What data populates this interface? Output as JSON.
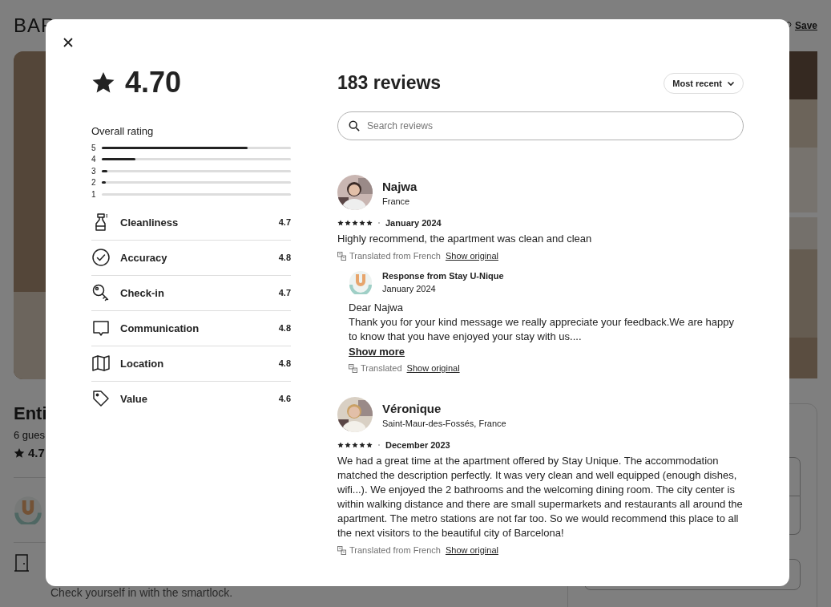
{
  "page": {
    "title": "BAR",
    "save": "Save",
    "listing_title": "Enti",
    "guests": "6 gues",
    "rating": "4.7",
    "checkin_text": "Check yourself in with the smartlock."
  },
  "modal": {
    "score": "4.70",
    "overall_label": "Overall rating",
    "distribution": [
      {
        "label": "5",
        "level": 0.77
      },
      {
        "label": "4",
        "level": 0.18
      },
      {
        "label": "3",
        "level": 0.03
      },
      {
        "label": "2",
        "level": 0.02
      },
      {
        "label": "1",
        "level": 0
      }
    ],
    "categories": [
      {
        "kind": "cleanliness",
        "label": "Cleanliness",
        "value": "4.7"
      },
      {
        "kind": "accuracy",
        "label": "Accuracy",
        "value": "4.8"
      },
      {
        "kind": "checkin",
        "label": "Check-in",
        "value": "4.7"
      },
      {
        "kind": "communication",
        "label": "Communication",
        "value": "4.8"
      },
      {
        "kind": "location",
        "label": "Location",
        "value": "4.8"
      },
      {
        "kind": "value",
        "label": "Value",
        "value": "4.6"
      }
    ],
    "count": "183 reviews",
    "sort": "Most recent",
    "search": {
      "placeholder": "Search reviews"
    },
    "reviews": [
      {
        "name": "Najwa",
        "location": "France",
        "stars": 5,
        "date": "January 2024",
        "text": "Highly recommend, the apartment was clean and clean",
        "translation": {
          "note": "Translated from French",
          "link": "Show original"
        },
        "response": {
          "title": "Response from Stay U-Nique",
          "date": "January 2024",
          "paragraphs": [
            "Dear Najwa",
            "Thank you for your kind message we really appreciate your feedback.We are happy to know that you have enjoyed your stay with us...."
          ],
          "more": "Show more",
          "translation": {
            "note": "Translated",
            "link": "Show original"
          }
        }
      },
      {
        "name": "Véronique",
        "location": "Saint-Maur-des-Fossés, France",
        "stars": 5,
        "date": "December 2023",
        "text": "We had a great time at the apartment offered by Stay Unique. The accommodation matched the description perfectly. It was very clean and well equipped (enough dishes, wifi...). We enjoyed the 2 bathrooms and the welcoming dining room. The city center is within walking distance and there are small supermarkets and restaurants all around the apartment. The metro stations are not far too. So we would recommend this place to all the next visitors to the beautiful city of Barcelona!",
        "translation": {
          "note": "Translated from French",
          "link": "Show original"
        }
      }
    ]
  }
}
